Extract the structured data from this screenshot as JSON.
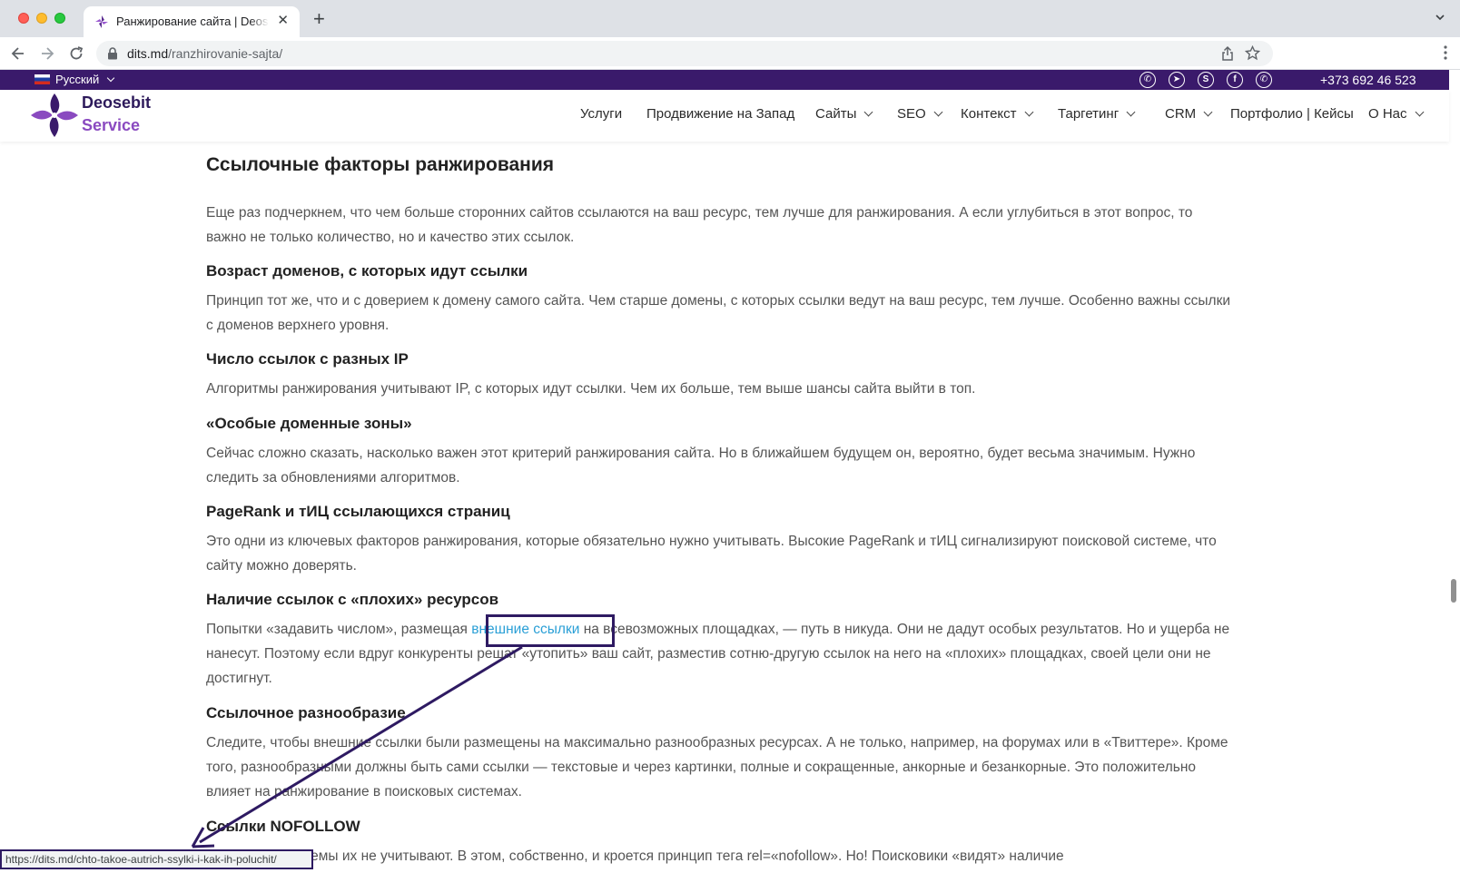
{
  "browser": {
    "tab_title": "Ранжирование сайта | Deosebit Service",
    "new_tab_label": "+",
    "url_host": "dits.md",
    "url_path": "/ranzhirovanie-sajta/",
    "status_url": "https://dits.md/chto-takoe-autrich-ssylki-i-kak-ih-poluchit/"
  },
  "topbar": {
    "language": "Русский",
    "phone": "+373 692 46 523",
    "social_icons": [
      "viber-icon",
      "telegram-icon",
      "skype-icon",
      "facebook-icon",
      "whatsapp-icon"
    ]
  },
  "logo": {
    "line1": "Deosebit",
    "line2": "Service"
  },
  "menu": [
    {
      "label": "Услуги",
      "dropdown": false
    },
    {
      "label": "Продвижение на Запад",
      "dropdown": false
    },
    {
      "label": "Сайты",
      "dropdown": true
    },
    {
      "label": "SEO",
      "dropdown": true
    },
    {
      "label": "Контекст",
      "dropdown": true
    },
    {
      "label": "Таргетинг",
      "dropdown": true
    },
    {
      "label": "CRM",
      "dropdown": true
    },
    {
      "label": "Портфолио | Кейсы",
      "dropdown": false
    },
    {
      "label": "О Нас",
      "dropdown": true
    }
  ],
  "article": {
    "title": "Ссылочные факторы ранжирования",
    "intro": "Еще раз подчеркнем, что чем больше сторонних сайтов ссылаются на ваш ресурс, тем лучше для ранжирования. А если углубиться в этот вопрос, то важно не только количество, но и качество этих ссылок.",
    "sections": [
      {
        "heading": "Возраст доменов, с которых идут ссылки",
        "text": "Принцип тот же, что и с доверием к домену самого сайта. Чем старше домены, с которых ссылки ведут на ваш ресурс, тем лучше. Особенно важны ссылки с доменов верхнего уровня."
      },
      {
        "heading": "Число ссылок с разных IP",
        "text": "Алгоритмы ранжирования учитывают IP, с которых идут ссылки. Чем их больше, тем выше шансы сайта выйти в топ."
      },
      {
        "heading": "«Особые доменные зоны»",
        "text": "Сейчас сложно сказать, насколько важен этот критерий ранжирования сайта. Но в ближайшем будущем он, вероятно, будет весьма значимым. Нужно следить за обновлениями алгоритмов."
      },
      {
        "heading": "PageRank и тИЦ ссылающихся страниц",
        "text": "Это одни из ключевых факторов ранжирования, которые обязательно нужно учитывать. Высокие PageRank и тИЦ сигнализируют поисковой системе, что сайту можно доверять."
      },
      {
        "heading": "Наличие ссылок с «плохих» ресурсов",
        "text_before": "Попытки «задавить числом», размещая ",
        "link": "внешние ссылки",
        "text_after": " на всевозможных площадках, — путь в никуда. Они не дадут особых результатов. Но и ущерба не нанесут. Поэтому если вдруг конкуренты решат «утопить» ваш сайт, разместив сотню-другую ссылок на него на «плохих» площадках, своей цели они не достигнут."
      },
      {
        "heading": "Ссылочное разнообразие",
        "text": "Следите, чтобы внешние ссылки были размещены на максимально разнообразных ресурсах. А не только, например, на форумах или в «Твиттере». Кроме того, разнообразными должны быть сами ссылки — текстовые и через картинки, полные и сокращенные, анкорные и безанкорные. Это положительно влияет на ранжирование в поисковых системах."
      },
      {
        "heading": "Ссылки NOFOLLOW",
        "text": "Поисковые системы их не учитывают. В этом, собственно, и кроется принцип тега rel=«nofollow». Но! Поисковики «видят» наличие"
      }
    ]
  },
  "colors": {
    "brand_purple": "#3a1a6b",
    "link_blue": "#2a9fd6",
    "annotation": "#2e1a62"
  }
}
